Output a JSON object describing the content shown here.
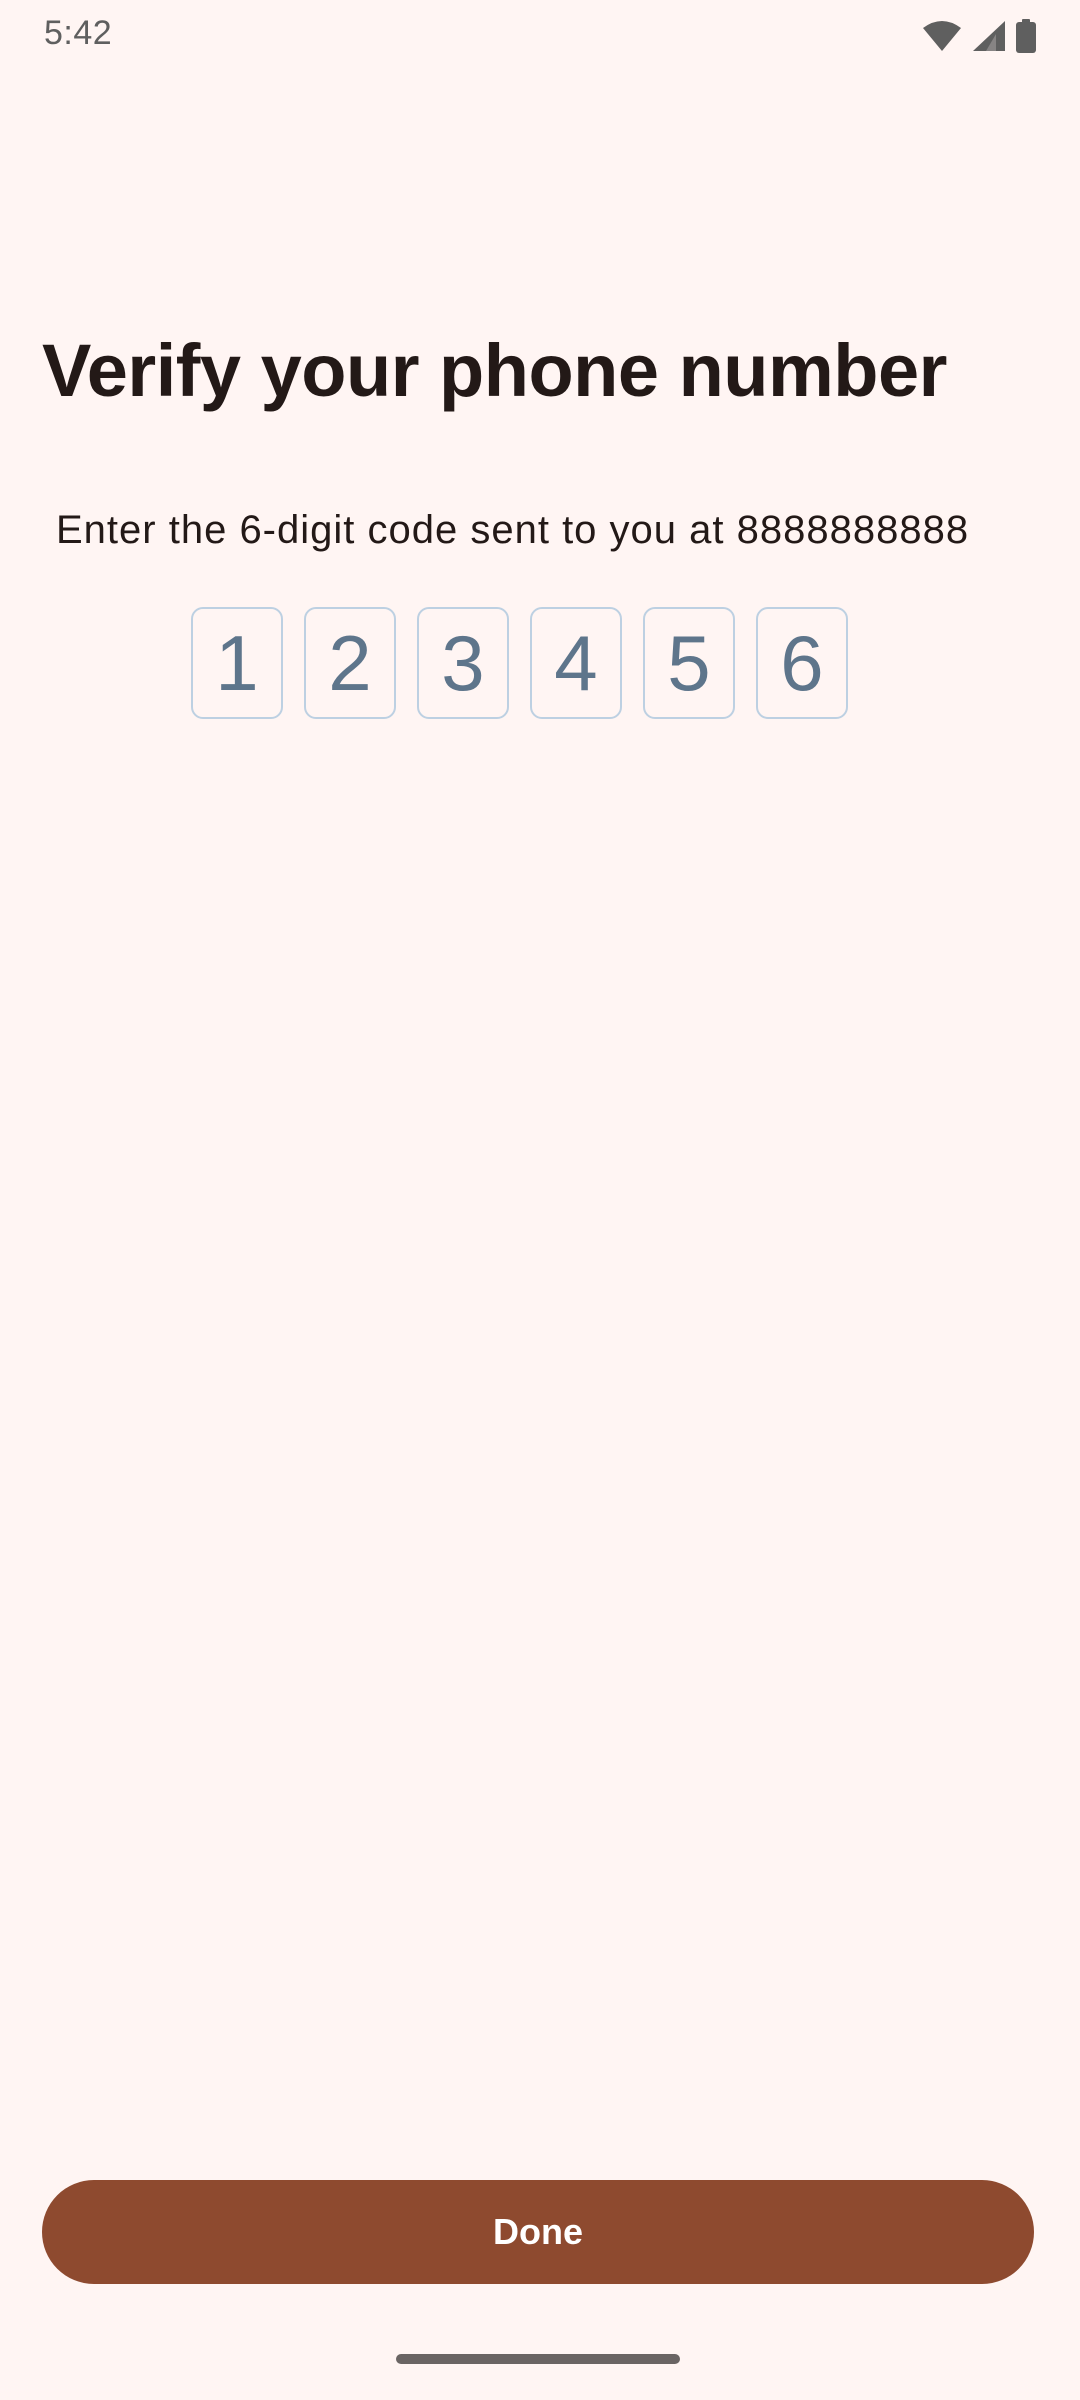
{
  "status_bar": {
    "time": "5:42",
    "icons": [
      "wifi-icon",
      "signal-icon",
      "battery-icon"
    ]
  },
  "page": {
    "title": "Verify your phone number",
    "subtitle": "Enter the 6-digit code sent to you at 8888888888"
  },
  "otp": {
    "digits": [
      "1",
      "2",
      "3",
      "4",
      "5",
      "6"
    ]
  },
  "actions": {
    "done_label": "Done"
  },
  "colors": {
    "background": "#FFF5F3",
    "primary": "#8E4A2F",
    "text": "#231917",
    "otp_text": "#5E758B",
    "otp_border": "#BDD0E2"
  }
}
